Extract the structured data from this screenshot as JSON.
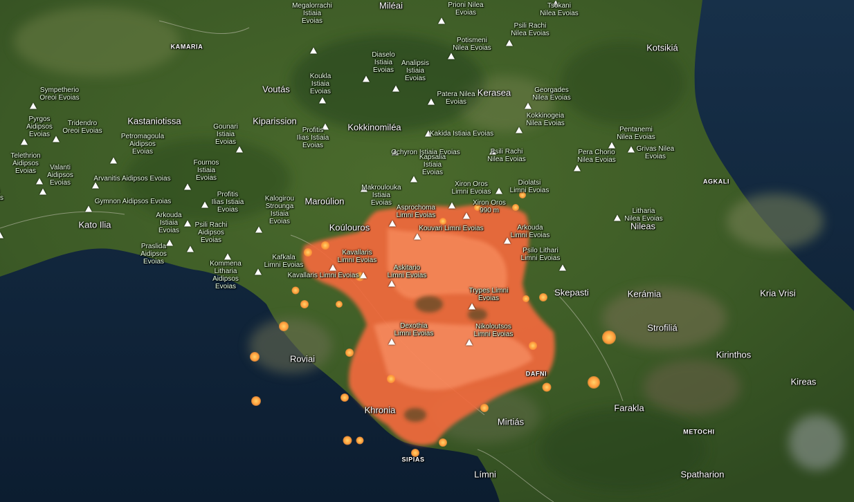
{
  "map": {
    "towns": [
      {
        "name": "Miléai"
      },
      {
        "name": "Kotsikiá"
      },
      {
        "name": "Voutás"
      },
      {
        "name": "Kerasea"
      },
      {
        "name": "Kastaniotissa"
      },
      {
        "name": "Kiparission"
      },
      {
        "name": "Kokkinomiléa"
      },
      {
        "name": "Maroúlion"
      },
      {
        "name": "Kato Ilia"
      },
      {
        "name": "Koúlouros"
      },
      {
        "name": "Nileas"
      },
      {
        "name": "Skepasti"
      },
      {
        "name": "Kerámia"
      },
      {
        "name": "Kria Vrisi"
      },
      {
        "name": "Strofiliá"
      },
      {
        "name": "Kirinthos"
      },
      {
        "name": "Roviai"
      },
      {
        "name": "Kireas"
      },
      {
        "name": "Farakla"
      },
      {
        "name": "Khronia"
      },
      {
        "name": "Mirtiás"
      },
      {
        "name": "Límni"
      },
      {
        "name": "Spatharion"
      }
    ],
    "caps_labels": [
      {
        "name": "KAMARIA"
      },
      {
        "name": "AGKALI"
      },
      {
        "name": "DAFNI"
      },
      {
        "name": "METOCHI"
      },
      {
        "name": "SIPIAS"
      }
    ],
    "peaks": [
      {
        "name": "Prioni Nilea\nEvoias"
      },
      {
        "name": "Tsokani\nNilea Evoias"
      },
      {
        "name": "Megalorrachi\nIstiaia\nEvoias"
      },
      {
        "name": "Psili Rachi\nNilea Evoias"
      },
      {
        "name": "Potismeni\nNilea Evoias"
      },
      {
        "name": "Diaselo\nIstiaia\nEvoias"
      },
      {
        "name": "Analipsis\nIstiaia\nEvoias"
      },
      {
        "name": "Koukla\nIstiaia\nEvoias"
      },
      {
        "name": "Sympetherio\nOreoi Evoias"
      },
      {
        "name": "Georgades\nNilea Evoias"
      },
      {
        "name": "Patera Nilea\nEvoias"
      },
      {
        "name": "Kokkinogeia\nNilea Evoias"
      },
      {
        "name": "Pyrgos\nAidipsos\nEvoias"
      },
      {
        "name": "Tridendro\nOreoi Evoias"
      },
      {
        "name": "Gounari\nIstiaia\nEvoias"
      },
      {
        "name": "Petromagoula\nAidipsos\nEvoias"
      },
      {
        "name": "Profitis\nIlias Istiaia\nEvoias"
      },
      {
        "name": "Kakida Istiaia Evoias"
      },
      {
        "name": "Ochyron Istiaia Evoias"
      },
      {
        "name": "Psili Rachi\nNilea Evoias"
      },
      {
        "name": "Pentanemi\nNilea Evoias"
      },
      {
        "name": "Grivas Nilea\nEvoias"
      },
      {
        "name": "Kapsalia\nIstiaia\nEvoias"
      },
      {
        "name": "Pera Chorio\nNilea Evoias"
      },
      {
        "name": "Telethrion\nAidipsos\nEvoias"
      },
      {
        "name": "Fournos\nIstiaia\nEvoias"
      },
      {
        "name": "Valanti\nAidipsos\nEvoias"
      },
      {
        "name": "Makroulouka\nIstiaia\nEvoias"
      },
      {
        "name": "Diolatsi\nLimni Evoias"
      },
      {
        "name": "Arvanitis Aidipsos Evoias"
      },
      {
        "name": "Xiron Oros\nLimni Evoias"
      },
      {
        "name": "Xiron Oros\n990 m"
      },
      {
        "name": "Profitis\nIlias Istiaia\nEvoias"
      },
      {
        "name": "Kalogirou\nStrounga\nIstiaia\nEvoias"
      },
      {
        "name": "Gymnon Aidipsos Evoias"
      },
      {
        "name": "Asprochoma\nLimni Evoias"
      },
      {
        "name": "Litharia\nNilea Evoias"
      },
      {
        "name": "Arkouda\nIstiaia\nEvoias"
      },
      {
        "name": "Psili Rachi\nAidipsos\nEvoias"
      },
      {
        "name": "Kouvari Limni Evoias"
      },
      {
        "name": "Arkouda\nLimni Evoias"
      },
      {
        "name": "Praslida\nAidipsos\nEvoias"
      },
      {
        "name": "Kavallaris\nLimni Evoias"
      },
      {
        "name": "Psilo Lithari\nLimni Evoias"
      },
      {
        "name": "Kafkala\nLimni Evoias"
      },
      {
        "name": "Kommena\nLitharia\nAidipsos\nEvoias"
      },
      {
        "name": "Askitario\nLimni Evoias"
      },
      {
        "name": "Kavallaris Limni Evoias"
      },
      {
        "name": "Trypes Limni\nEvoias"
      },
      {
        "name": "Dexothia\nLimni Evoias"
      },
      {
        "name": "Nikolоutsos\nLimni Evoias"
      },
      {
        "name": "Ona\nEvoias"
      }
    ]
  }
}
